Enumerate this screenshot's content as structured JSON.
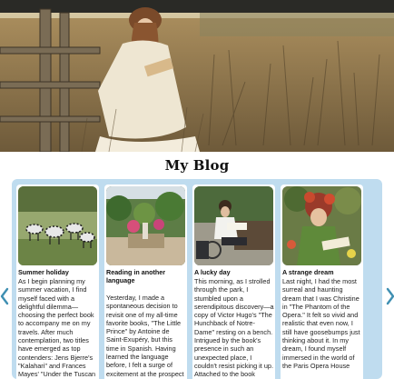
{
  "hero": {
    "image_icon": "woman-reading-in-meadow-photo"
  },
  "page": {
    "title": "My Blog"
  },
  "carousel": {
    "prev_icon": "chevron-left-icon",
    "next_icon": "chevron-right-icon",
    "background_color": "#bfdcef",
    "cards": [
      {
        "image_icon": "zebras-photo",
        "title": "Summer holiday",
        "text": "As I begin planning my summer vacation, I find myself faced with a delightful dilemma—choosing the perfect book to accompany me on my travels. After much contemplation, two titles have emerged as top contenders: Jens Bjerre's \"Kalahari\" and Frances Mayes' \"Under the Tuscan"
      },
      {
        "image_icon": "garden-fountain-photo",
        "title": "Reading in another language",
        "text": "Yesterday, I made a spontaneous decision to revisit one of my all-time favorite books, \"The Little Prince\" by Antoine de Saint-Exupéry, but this time in Spanish. Having learned the language before, I felt a surge of excitement at the prospect of immersing"
      },
      {
        "image_icon": "woman-reading-on-bench-photo",
        "title": "A lucky day",
        "text": "This morning, as I strolled through the park, I stumbled upon a serendipitous discovery—a copy of Victor Hugo's \"The Hunchback of Notre-Dame\" resting on a bench. Intrigued by the book's presence in such an unexpected place, I couldn't resist picking it up. Attached to the book"
      },
      {
        "image_icon": "girl-reading-with-flowers-photo",
        "title": "A strange dream",
        "text": "Last night, I had the most surreal and haunting dream that I was Christine in \"The Phantom of the Opera.\" It felt so vivid and realistic that even now, I still have goosebumps just thinking about it. In my dream, I found myself immersed in the world of the Paris Opera House"
      }
    ]
  }
}
